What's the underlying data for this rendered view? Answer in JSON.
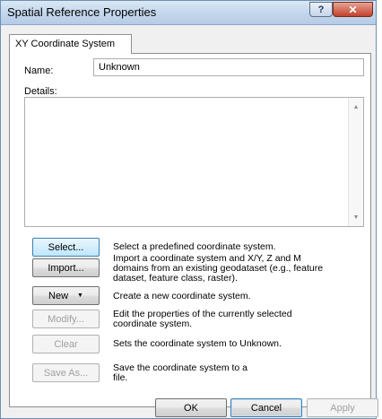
{
  "window": {
    "title": "Spatial Reference Properties",
    "help_label": "?",
    "close_label": "✕"
  },
  "tab": {
    "label": "XY Coordinate System"
  },
  "name": {
    "label": "Name:",
    "value": "Unknown"
  },
  "details": {
    "label": "Details:",
    "value": ""
  },
  "actions": [
    {
      "label": "Select...",
      "description": "Select a predefined coordinate system."
    },
    {
      "label": "Import...",
      "description": "Import a coordinate system and X/Y, Z and M domains from an existing geodataset (e.g., feature dataset, feature class, raster)."
    },
    {
      "label": "New",
      "description": "Create a new coordinate system."
    },
    {
      "label": "Modify...",
      "description": "Edit the properties of the currently selected coordinate system."
    },
    {
      "label": "Clear",
      "description": "Sets the coordinate system to Unknown."
    },
    {
      "label": "Save As...",
      "description": "Save the coordinate system to a file."
    }
  ],
  "footer": {
    "ok_label": "OK",
    "cancel_label": "Cancel",
    "apply_label": "Apply"
  },
  "icons": {
    "scroll_up": "scroll-up-arrow-icon",
    "scroll_down": "scroll-down-arrow-icon",
    "dropdown": "dropdown-arrow-icon",
    "help": "help-icon",
    "close": "close-icon"
  }
}
